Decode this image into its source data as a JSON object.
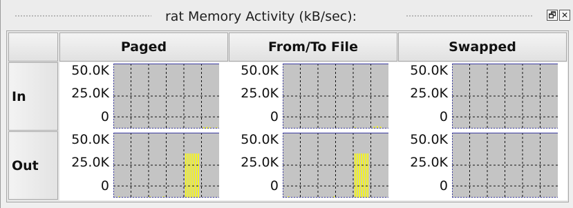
{
  "window": {
    "title": "rat Memory Activity (kB/sec):",
    "restore_icon": "restore-window-icon",
    "close_icon": "close-icon",
    "restore_glyph": "🗗",
    "close_glyph": "✕"
  },
  "table": {
    "columns": [
      "Paged",
      "From/To File",
      "Swapped"
    ],
    "rows": [
      "In",
      "Out"
    ]
  },
  "axis": {
    "ticks": [
      "50.0K",
      "25.0K",
      "0"
    ],
    "ymax_kb": 50.0
  },
  "colors": {
    "plot_bg": "#c4c4c4",
    "bar": "#ffff00",
    "grid": "#111111",
    "line": "#3a3aa0"
  },
  "chart_data": [
    {
      "type": "bar",
      "row": "In",
      "column": "Paged",
      "ylim": [
        0,
        50000
      ],
      "bars": [
        {
          "x": 0.85,
          "y": 800
        },
        {
          "x": 0.88,
          "y": 1200
        },
        {
          "x": 0.91,
          "y": 900
        },
        {
          "x": 0.97,
          "y": 1000
        }
      ]
    },
    {
      "type": "bar",
      "row": "In",
      "column": "From/To File",
      "ylim": [
        0,
        50000
      ],
      "bars": [
        {
          "x": 0.68,
          "y": 500
        },
        {
          "x": 0.86,
          "y": 1600
        },
        {
          "x": 0.89,
          "y": 1800
        },
        {
          "x": 0.92,
          "y": 1500
        }
      ]
    },
    {
      "type": "bar",
      "row": "In",
      "column": "Swapped",
      "ylim": [
        0,
        50000
      ],
      "bars": []
    },
    {
      "type": "bar",
      "row": "Out",
      "column": "Paged",
      "ylim": [
        0,
        50000
      ],
      "bars": [
        {
          "x": 0.05,
          "y": 600
        },
        {
          "x": 0.34,
          "y": 500
        },
        {
          "x": 0.47,
          "y": 400
        },
        {
          "x": 0.68,
          "y": 34000
        },
        {
          "x": 0.7,
          "y": 34000
        },
        {
          "x": 0.72,
          "y": 34000
        },
        {
          "x": 0.74,
          "y": 34000
        },
        {
          "x": 0.76,
          "y": 34000
        },
        {
          "x": 0.78,
          "y": 34000
        },
        {
          "x": 0.8,
          "y": 34000
        }
      ]
    },
    {
      "type": "bar",
      "row": "Out",
      "column": "From/To File",
      "ylim": [
        0,
        50000
      ],
      "bars": [
        {
          "x": 0.05,
          "y": 600
        },
        {
          "x": 0.48,
          "y": 400
        },
        {
          "x": 0.68,
          "y": 34000
        },
        {
          "x": 0.7,
          "y": 34000
        },
        {
          "x": 0.72,
          "y": 34000
        },
        {
          "x": 0.74,
          "y": 34000
        },
        {
          "x": 0.76,
          "y": 34000
        },
        {
          "x": 0.78,
          "y": 34000
        },
        {
          "x": 0.8,
          "y": 34000
        }
      ]
    },
    {
      "type": "bar",
      "row": "Out",
      "column": "Swapped",
      "ylim": [
        0,
        50000
      ],
      "bars": []
    }
  ]
}
